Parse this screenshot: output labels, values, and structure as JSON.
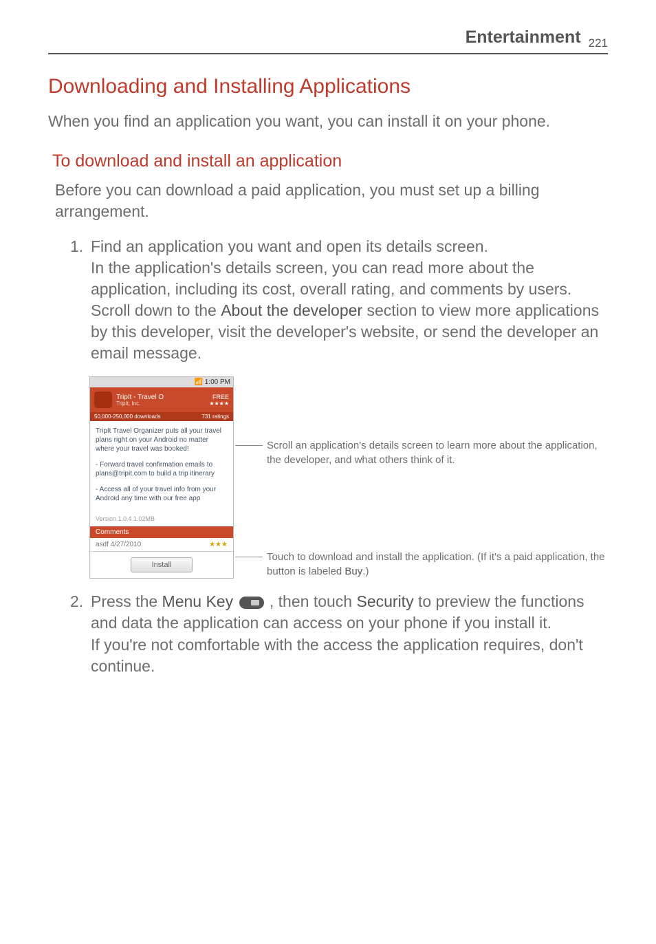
{
  "header": {
    "section": "Entertainment",
    "page_number": "221"
  },
  "title": "Downloading and Installing Applications",
  "intro": "When you find an application you want, you can install it on your phone.",
  "subtitle": "To download and install an application",
  "subintro": "Before you can download a paid application, you must set up a billing arrangement.",
  "item1": {
    "num": "1.",
    "p1": "Find an application you want and open its details screen.",
    "p2a": "In the application's details screen, you can read more about the application, including its cost, overall rating, and comments by users. Scroll down to the ",
    "p2b": "About the developer",
    "p2c": " section to view more applications by this developer, visit the developer's website, or send the developer an email message."
  },
  "phone": {
    "time": "1:00 PM",
    "app_title": "TripIt - Travel O",
    "app_sub": "TripIt, Inc.",
    "price": "FREE",
    "stars": "★★★★",
    "dl_count": "50,000-250,000 downloads",
    "ratings": "731 ratings",
    "body1": "TripIt Travel Organizer puts all your travel plans right on your Android no matter where your travel was booked!",
    "body2": "- Forward travel confirmation emails to plans@tripit.com to build a trip itinerary",
    "body3": "- Access all of your travel info from your Android any time with our free app",
    "version": "Version 1.0.4   1.02MB",
    "comments": "Comments",
    "comment_user": "asdf  4/27/2010",
    "comment_stars": "★★★",
    "install": "Install"
  },
  "callout1": "Scroll an application's details screen to learn more about the application, the developer, and what others think of it.",
  "callout2_a": "Touch to download and install the application. (If it's a paid application, the button is labeled ",
  "callout2_b": "Buy",
  "callout2_c": ".)",
  "item2": {
    "num": "2.",
    "p1a": "Press the ",
    "p1b": "Menu Key",
    "p1c": " , then touch ",
    "p1d": "Security",
    "p1e": " to preview the functions and data the application can access on your phone if you install it.",
    "p2": "If you're not comfortable with the access the application requires, don't continue."
  }
}
